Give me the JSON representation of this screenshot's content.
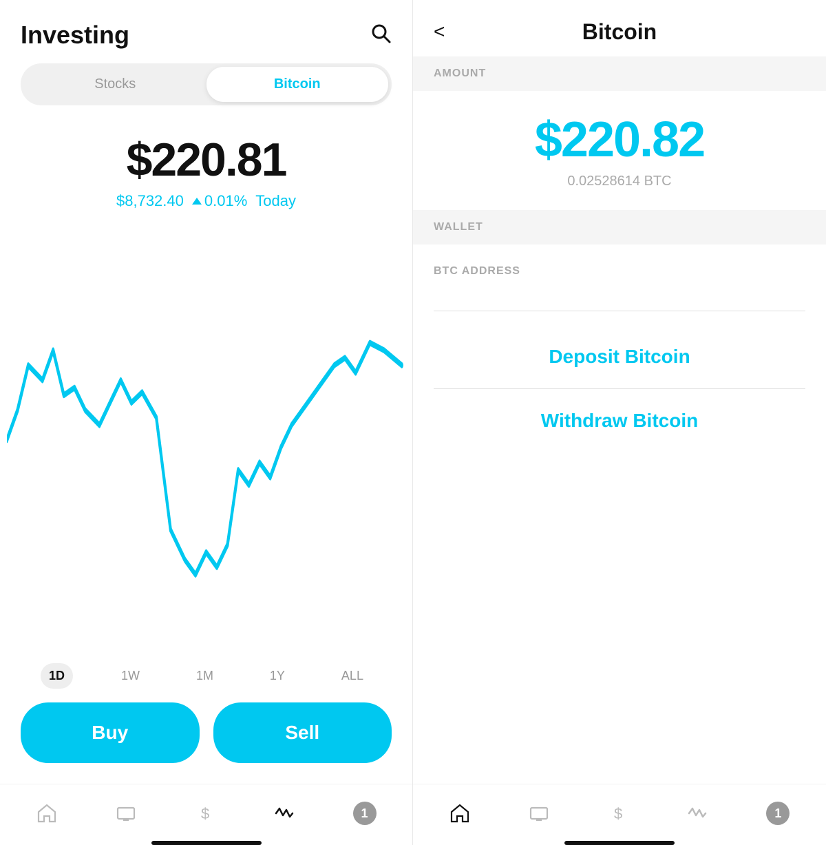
{
  "left": {
    "header": {
      "title": "Investing",
      "search_icon": "🔍"
    },
    "tabs": [
      {
        "label": "Stocks",
        "active": false
      },
      {
        "label": "Bitcoin",
        "active": true
      }
    ],
    "price": {
      "main": "$220.81",
      "btc_price": "$8,732.40",
      "change": "0.01%",
      "period": "Today"
    },
    "time_ranges": [
      {
        "label": "1D",
        "active": true
      },
      {
        "label": "1W",
        "active": false
      },
      {
        "label": "1M",
        "active": false
      },
      {
        "label": "1Y",
        "active": false
      },
      {
        "label": "ALL",
        "active": false
      }
    ],
    "buttons": {
      "buy": "Buy",
      "sell": "Sell"
    },
    "nav": {
      "items": [
        "home",
        "tv",
        "dollar",
        "activity",
        "bell"
      ],
      "badge_count": "1"
    }
  },
  "right": {
    "header": {
      "back": "<",
      "title": "Bitcoin"
    },
    "amount_section": {
      "label": "AMOUNT",
      "usd": "$220.82",
      "btc": "0.02528614 BTC"
    },
    "wallet_section": {
      "label": "WALLET",
      "btc_address_label": "BTC ADDRESS"
    },
    "actions": {
      "deposit": "Deposit Bitcoin",
      "withdraw": "Withdraw Bitcoin"
    },
    "nav": {
      "badge_count": "1"
    }
  }
}
